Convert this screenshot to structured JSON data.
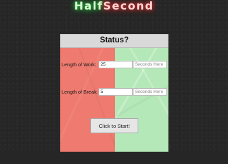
{
  "app": {
    "title_part1": "Half",
    "title_part2": "Second",
    "colors": {
      "background": "#262626",
      "title_green_glow": "#2ecc40",
      "title_red_glow": "#e53935",
      "work_side": "#ef7b70",
      "break_side": "#b5e8b8"
    }
  },
  "panel": {
    "header": "Status?",
    "work": {
      "label": "Length of Work:",
      "value": "25",
      "seconds_placeholder": "Seconds Here"
    },
    "break": {
      "label": "Length of Break:",
      "value": "5",
      "seconds_placeholder": "Seconds Here"
    },
    "start_button": "Click to Start!"
  }
}
